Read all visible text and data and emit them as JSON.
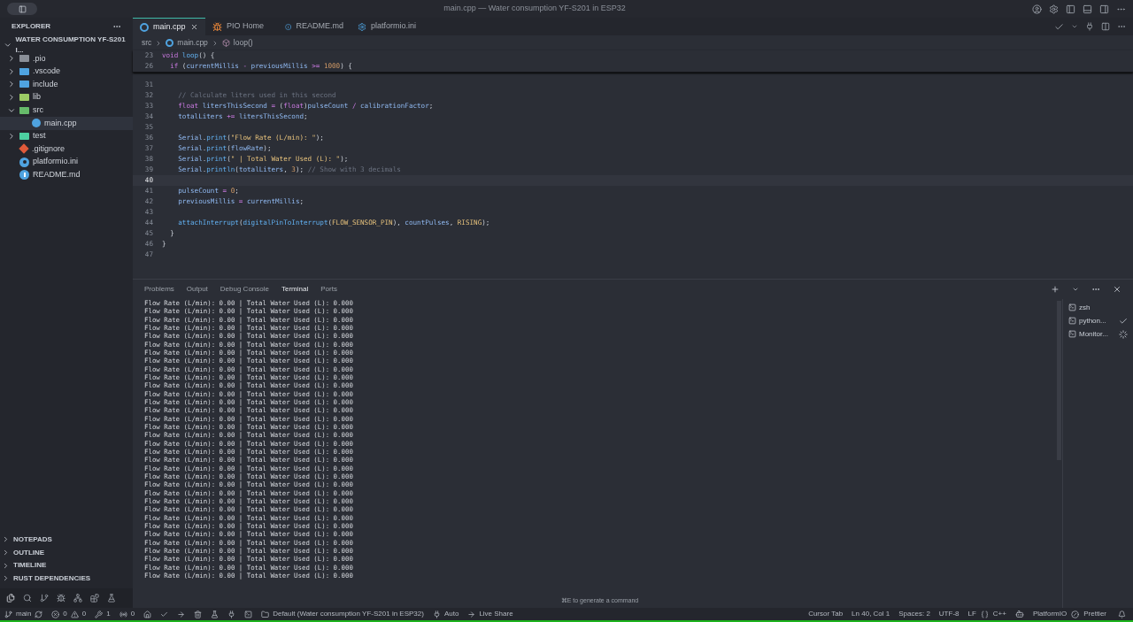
{
  "window": {
    "title": "main.cpp — Water consumption YF-S201 in ESP32"
  },
  "sidebar": {
    "title": "EXPLORER",
    "project": "WATER CONSUMPTION YF-S201 I...",
    "items": [
      {
        "label": ".pio",
        "kind": "folder",
        "expanded": false,
        "selected": false,
        "color": "#8a8f98"
      },
      {
        "label": ".vscode",
        "kind": "folder",
        "expanded": false,
        "selected": false,
        "color": "#4fa3e0"
      },
      {
        "label": "include",
        "kind": "folder",
        "expanded": false,
        "selected": false,
        "color": "#4fa3e0"
      },
      {
        "label": "lib",
        "kind": "folder",
        "expanded": false,
        "selected": false,
        "color": "#9ccc65"
      },
      {
        "label": "src",
        "kind": "folder",
        "expanded": true,
        "selected": false,
        "color": "#66bb6a",
        "children": [
          {
            "label": "main.cpp",
            "kind": "cpp",
            "selected": true,
            "color": "#4fa3e0"
          }
        ]
      },
      {
        "label": "test",
        "kind": "folder",
        "expanded": false,
        "selected": false,
        "color": "#4dd0a0"
      },
      {
        "label": ".gitignore",
        "kind": "git",
        "selected": false,
        "color": "#e05a3a"
      },
      {
        "label": "platformio.ini",
        "kind": "gear",
        "selected": false,
        "color": "#4fa3e0"
      },
      {
        "label": "README.md",
        "kind": "info",
        "selected": false,
        "color": "#4fa3e0"
      }
    ],
    "sections": [
      "NOTEPADS",
      "OUTLINE",
      "TIMELINE",
      "RUST DEPENDENCIES"
    ]
  },
  "tabs": [
    {
      "label": "main.cpp",
      "kind": "cpp",
      "selected": true
    },
    {
      "label": "PIO Home",
      "kind": "pio",
      "selected": false
    },
    {
      "label": "README.md",
      "kind": "info",
      "selected": false
    },
    {
      "label": "platformio.ini",
      "kind": "gear",
      "selected": false
    }
  ],
  "breadcrumb": [
    "src",
    "main.cpp",
    "loop()"
  ],
  "sticky_lines": [
    {
      "number": "23",
      "tokens": [
        {
          "kind": "keyword",
          "text": "void "
        },
        {
          "kind": "function",
          "text": "loop"
        },
        {
          "kind": "punct",
          "text": "() {"
        }
      ]
    },
    {
      "number": "26",
      "tokens": [
        {
          "kind": "keyword",
          "text": "  if "
        },
        {
          "kind": "punct",
          "text": "("
        },
        {
          "kind": "variable",
          "text": "currentMillis"
        },
        {
          "kind": "operator",
          "text": " - "
        },
        {
          "kind": "variable",
          "text": "previousMillis"
        },
        {
          "kind": "operator",
          "text": " >= "
        },
        {
          "kind": "number",
          "text": "1000"
        },
        {
          "kind": "punct",
          "text": ") {"
        }
      ]
    }
  ],
  "code_lines": [
    {
      "number": "31",
      "current": false
    },
    {
      "number": "32",
      "current": false,
      "tokens": [
        {
          "kind": "comment",
          "text": "    // Calculate liters used in this second"
        }
      ]
    },
    {
      "number": "33",
      "current": false,
      "tokens": [
        {
          "kind": "keyword",
          "text": "    float "
        },
        {
          "kind": "variable",
          "text": "litersThisSecond"
        },
        {
          "kind": "operator",
          "text": " = "
        },
        {
          "kind": "punct",
          "text": "("
        },
        {
          "kind": "keyword",
          "text": "float"
        },
        {
          "kind": "punct",
          "text": ")"
        },
        {
          "kind": "variable",
          "text": "pulseCount"
        },
        {
          "kind": "operator",
          "text": " / "
        },
        {
          "kind": "variable",
          "text": "calibrationFactor"
        },
        {
          "kind": "punct",
          "text": ";"
        }
      ]
    },
    {
      "number": "34",
      "current": false,
      "tokens": [
        {
          "kind": "variable",
          "text": "    totalLiters"
        },
        {
          "kind": "operator",
          "text": " += "
        },
        {
          "kind": "variable",
          "text": "litersThisSecond"
        },
        {
          "kind": "punct",
          "text": ";"
        }
      ]
    },
    {
      "number": "35",
      "current": false
    },
    {
      "number": "36",
      "current": false,
      "tokens": [
        {
          "kind": "variable",
          "text": "    Serial"
        },
        {
          "kind": "punct",
          "text": "."
        },
        {
          "kind": "function",
          "text": "print"
        },
        {
          "kind": "punct",
          "text": "("
        },
        {
          "kind": "string",
          "text": "\"Flow Rate (L/min): \""
        },
        {
          "kind": "punct",
          "text": ");"
        }
      ]
    },
    {
      "number": "37",
      "current": false,
      "tokens": [
        {
          "kind": "variable",
          "text": "    Serial"
        },
        {
          "kind": "punct",
          "text": "."
        },
        {
          "kind": "function",
          "text": "print"
        },
        {
          "kind": "punct",
          "text": "("
        },
        {
          "kind": "variable",
          "text": "flowRate"
        },
        {
          "kind": "punct",
          "text": ");"
        }
      ]
    },
    {
      "number": "38",
      "current": false,
      "tokens": [
        {
          "kind": "variable",
          "text": "    Serial"
        },
        {
          "kind": "punct",
          "text": "."
        },
        {
          "kind": "function",
          "text": "print"
        },
        {
          "kind": "punct",
          "text": "("
        },
        {
          "kind": "string",
          "text": "\" | Total Water Used (L): \""
        },
        {
          "kind": "punct",
          "text": ");"
        }
      ]
    },
    {
      "number": "39",
      "current": false,
      "tokens": [
        {
          "kind": "variable",
          "text": "    Serial"
        },
        {
          "kind": "punct",
          "text": "."
        },
        {
          "kind": "function",
          "text": "println"
        },
        {
          "kind": "punct",
          "text": "("
        },
        {
          "kind": "variable",
          "text": "totalLiters"
        },
        {
          "kind": "punct",
          "text": ", "
        },
        {
          "kind": "number",
          "text": "3"
        },
        {
          "kind": "punct",
          "text": "); "
        },
        {
          "kind": "comment",
          "text": "// Show with 3 decimals"
        }
      ]
    },
    {
      "number": "40",
      "current": true
    },
    {
      "number": "41",
      "current": false,
      "tokens": [
        {
          "kind": "variable",
          "text": "    pulseCount"
        },
        {
          "kind": "operator",
          "text": " = "
        },
        {
          "kind": "number",
          "text": "0"
        },
        {
          "kind": "punct",
          "text": ";"
        }
      ]
    },
    {
      "number": "42",
      "current": false,
      "tokens": [
        {
          "kind": "variable",
          "text": "    previousMillis"
        },
        {
          "kind": "operator",
          "text": " = "
        },
        {
          "kind": "variable",
          "text": "currentMillis"
        },
        {
          "kind": "punct",
          "text": ";"
        }
      ]
    },
    {
      "number": "43",
      "current": false
    },
    {
      "number": "44",
      "current": false,
      "tokens": [
        {
          "kind": "function",
          "text": "    attachInterrupt"
        },
        {
          "kind": "punct",
          "text": "("
        },
        {
          "kind": "function",
          "text": "digitalPinToInterrupt"
        },
        {
          "kind": "punct",
          "text": "("
        },
        {
          "kind": "string",
          "text": "FLOW_SENSOR_PIN"
        },
        {
          "kind": "punct",
          "text": "), "
        },
        {
          "kind": "variable",
          "text": "countPulses"
        },
        {
          "kind": "punct",
          "text": ", "
        },
        {
          "kind": "string",
          "text": "RISING"
        },
        {
          "kind": "punct",
          "text": ");"
        }
      ]
    },
    {
      "number": "45",
      "current": false,
      "tokens": [
        {
          "kind": "punct",
          "text": "  }"
        }
      ]
    },
    {
      "number": "46",
      "current": false,
      "tokens": [
        {
          "kind": "punct",
          "text": "}"
        }
      ]
    },
    {
      "number": "47",
      "current": false
    }
  ],
  "panel": {
    "tabs": [
      {
        "label": "Problems",
        "selected": false
      },
      {
        "label": "Output",
        "selected": false
      },
      {
        "label": "Debug Console",
        "selected": false
      },
      {
        "label": "Terminal",
        "selected": true
      },
      {
        "label": "Ports",
        "selected": false
      }
    ],
    "terminal_lines": [
      "Flow Rate (L/min): 0.00 | Total Water Used (L): 0.000",
      "Flow Rate (L/min): 0.00 | Total Water Used (L): 0.000",
      "Flow Rate (L/min): 0.00 | Total Water Used (L): 0.000",
      "Flow Rate (L/min): 0.00 | Total Water Used (L): 0.000",
      "Flow Rate (L/min): 0.00 | Total Water Used (L): 0.000",
      "Flow Rate (L/min): 0.00 | Total Water Used (L): 0.000",
      "Flow Rate (L/min): 0.00 | Total Water Used (L): 0.000",
      "Flow Rate (L/min): 0.00 | Total Water Used (L): 0.000",
      "Flow Rate (L/min): 0.00 | Total Water Used (L): 0.000",
      "Flow Rate (L/min): 0.00 | Total Water Used (L): 0.000",
      "Flow Rate (L/min): 0.00 | Total Water Used (L): 0.000",
      "Flow Rate (L/min): 0.00 | Total Water Used (L): 0.000",
      "Flow Rate (L/min): 0.00 | Total Water Used (L): 0.000",
      "Flow Rate (L/min): 0.00 | Total Water Used (L): 0.000",
      "Flow Rate (L/min): 0.00 | Total Water Used (L): 0.000",
      "Flow Rate (L/min): 0.00 | Total Water Used (L): 0.000",
      "Flow Rate (L/min): 0.00 | Total Water Used (L): 0.000",
      "Flow Rate (L/min): 0.00 | Total Water Used (L): 0.000",
      "Flow Rate (L/min): 0.00 | Total Water Used (L): 0.000",
      "Flow Rate (L/min): 0.00 | Total Water Used (L): 0.000",
      "Flow Rate (L/min): 0.00 | Total Water Used (L): 0.000",
      "Flow Rate (L/min): 0.00 | Total Water Used (L): 0.000",
      "Flow Rate (L/min): 0.00 | Total Water Used (L): 0.000",
      "Flow Rate (L/min): 0.00 | Total Water Used (L): 0.000",
      "Flow Rate (L/min): 0.00 | Total Water Used (L): 0.000",
      "Flow Rate (L/min): 0.00 | Total Water Used (L): 0.000",
      "Flow Rate (L/min): 0.00 | Total Water Used (L): 0.000",
      "Flow Rate (L/min): 0.00 | Total Water Used (L): 0.000",
      "Flow Rate (L/min): 0.00 | Total Water Used (L): 0.000",
      "Flow Rate (L/min): 0.00 | Total Water Used (L): 0.000",
      "Flow Rate (L/min): 0.00 | Total Water Used (L): 0.000",
      "Flow Rate (L/min): 0.00 | Total Water Used (L): 0.000",
      "Flow Rate (L/min): 0.00 | Total Water Used (L): 0.000",
      "Flow Rate (L/min): 0.00 | Total Water Used (L): 0.000"
    ],
    "terminals": [
      {
        "label": "zsh",
        "kind": "plain"
      },
      {
        "label": "python...",
        "kind": "done"
      },
      {
        "label": "Monitor...",
        "kind": "running"
      }
    ],
    "hint": "⌘E to generate a command"
  },
  "status_bar": {
    "branch": "main",
    "errors": "0",
    "warnings": "0",
    "tools": "1",
    "ports": "0",
    "env": "Default (Water consumption YF-S201 in ESP32)",
    "auto": "Auto",
    "live_share": "Live Share",
    "right": [
      "Cursor Tab",
      "Ln 40, Col 1",
      "Spaces: 2",
      "UTF-8",
      "LF",
      "C++",
      "PlatformIO",
      "Prettier"
    ]
  }
}
